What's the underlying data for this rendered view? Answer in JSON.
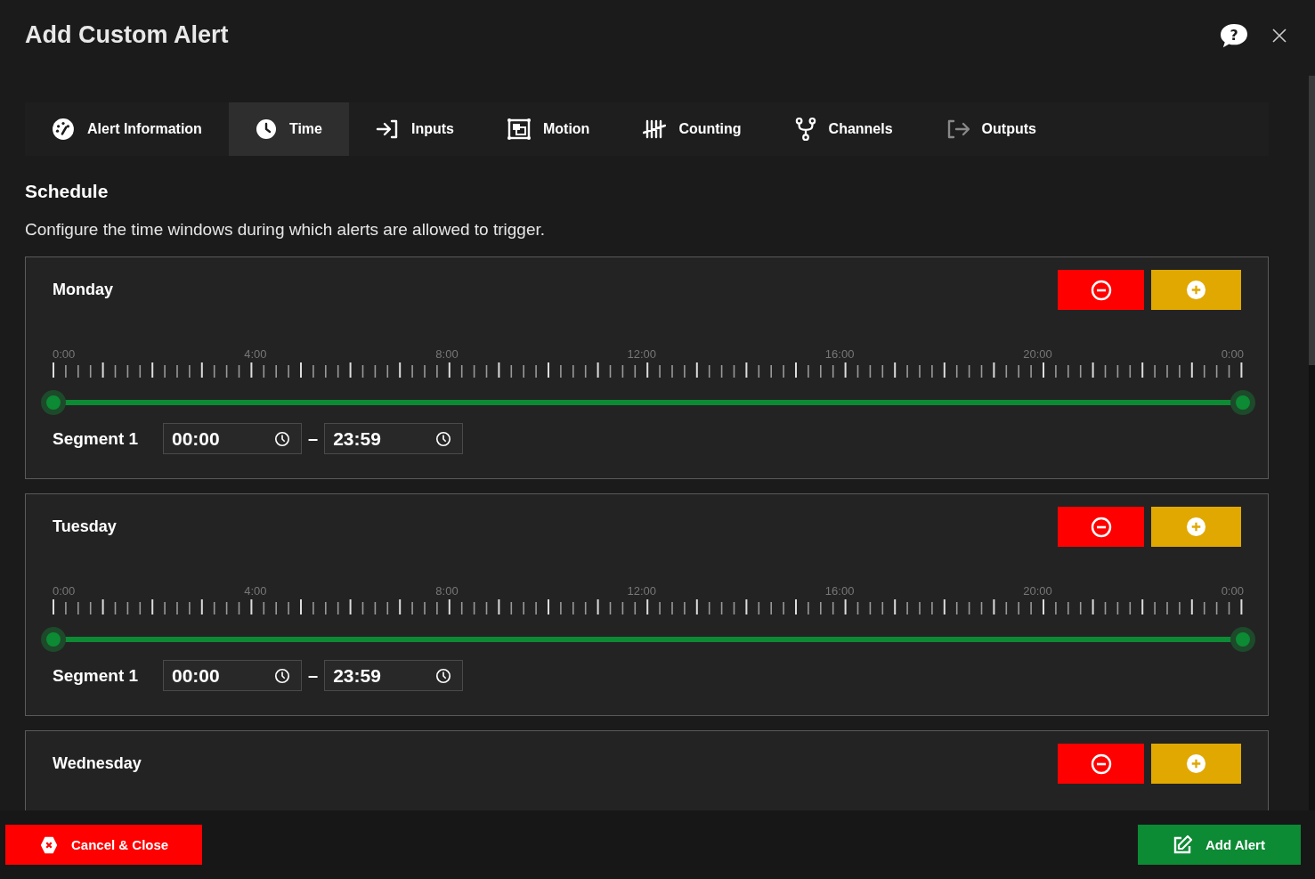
{
  "window": {
    "title": "Add Custom Alert",
    "help_mark": "?"
  },
  "tabs": [
    {
      "label": "Alert Information",
      "kind": "gauge",
      "selected": false
    },
    {
      "label": "Time",
      "kind": "clock",
      "selected": true
    },
    {
      "label": "Inputs",
      "kind": "login",
      "selected": false
    },
    {
      "label": "Motion",
      "kind": "motion",
      "selected": false
    },
    {
      "label": "Counting",
      "kind": "tally",
      "selected": false
    },
    {
      "label": "Channels",
      "kind": "fork",
      "selected": false
    },
    {
      "label": "Outputs",
      "kind": "logout",
      "selected": false
    }
  ],
  "section": {
    "title": "Schedule",
    "description": "Configure the time windows during which alerts are allowed to trigger."
  },
  "days": [
    {
      "name": "Monday",
      "tick_labels": [
        "0:00",
        "4:00",
        "8:00",
        "12:00",
        "16:00",
        "20:00",
        "0:00"
      ],
      "segments": [
        {
          "label": "Segment 1",
          "start": "00:00",
          "end": "23:59",
          "separator": "–",
          "level": 1
        }
      ]
    },
    {
      "name": "Tuesday",
      "tick_labels": [
        "0:00",
        "4:00",
        "8:00",
        "12:00",
        "16:00",
        "20:00",
        "0:00"
      ],
      "segments": [
        {
          "label": "Segment 1",
          "start": "00:00",
          "end": "23:59",
          "separator": "–",
          "level": 1
        }
      ]
    },
    {
      "name": "Wednesday"
    }
  ],
  "footer": {
    "cancel": "Cancel & Close",
    "submit": "Add Alert"
  }
}
